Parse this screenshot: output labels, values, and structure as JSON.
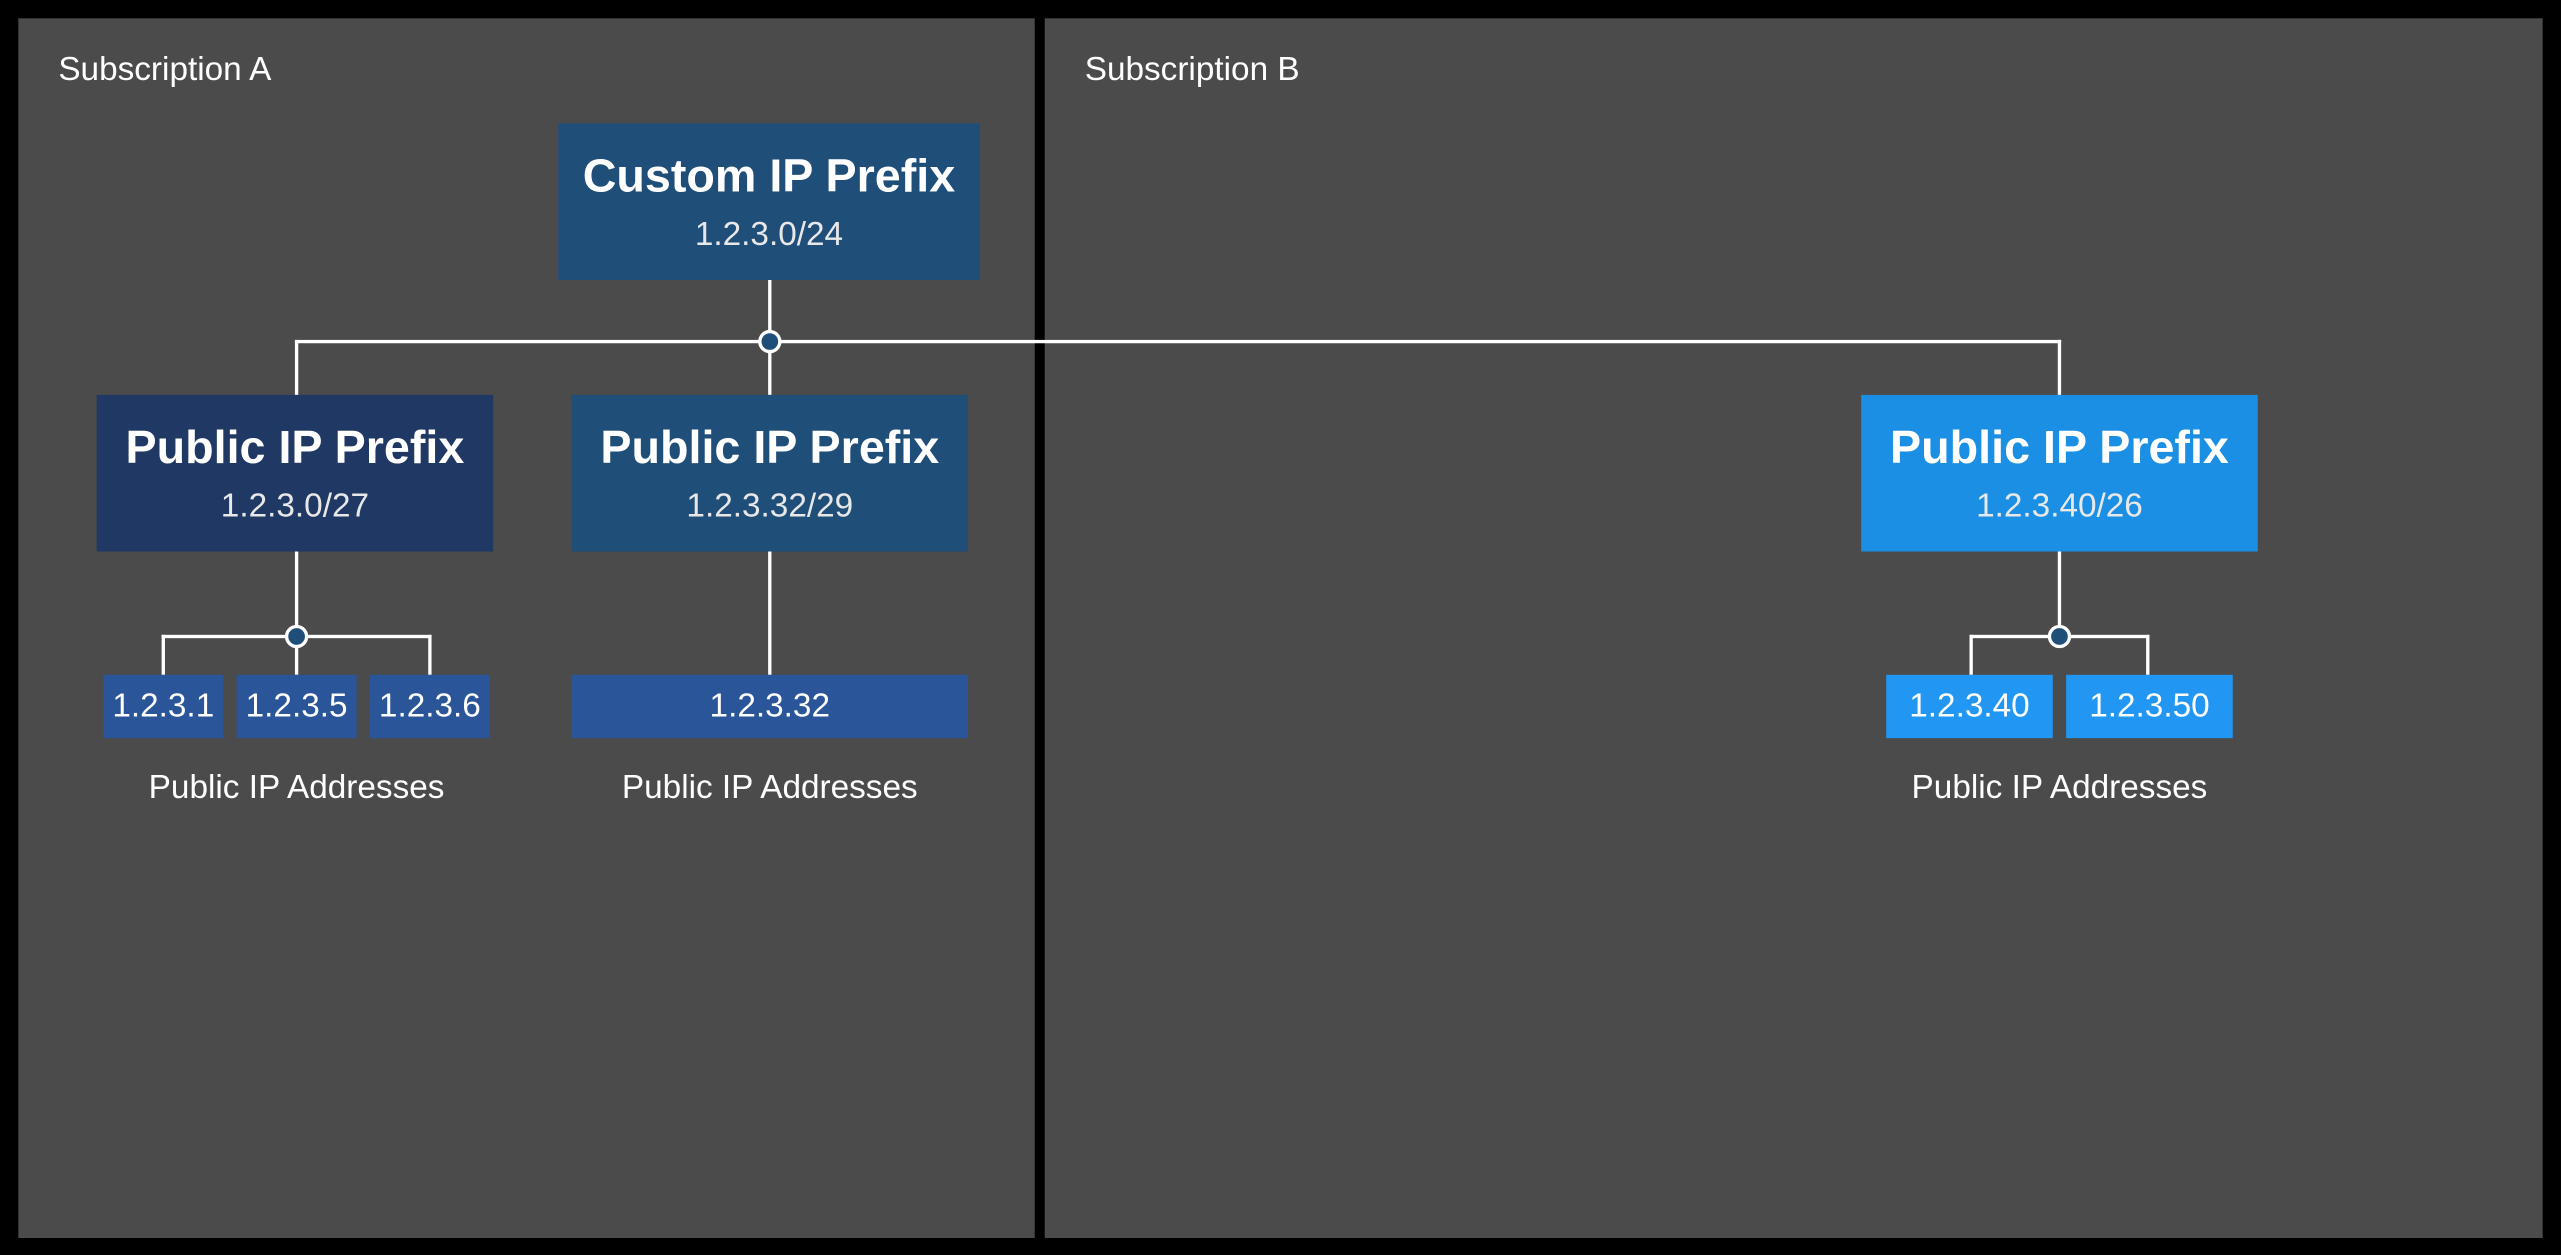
{
  "subscriptionA": {
    "label": "Subscription A"
  },
  "subscriptionB": {
    "label": "Subscription B"
  },
  "customPrefix": {
    "title": "Custom IP Prefix",
    "cidr": "1.2.3.0/24"
  },
  "publicPrefix1": {
    "title": "Public IP Prefix",
    "cidr": "1.2.3.0/27"
  },
  "publicPrefix2": {
    "title": "Public IP Prefix",
    "cidr": "1.2.3.32/29"
  },
  "publicPrefix3": {
    "title": "Public IP Prefix",
    "cidr": "1.2.3.40/26"
  },
  "ips1": {
    "a": "1.2.3.1",
    "b": "1.2.3.5",
    "c": "1.2.3.6"
  },
  "ips2": {
    "a": "1.2.3.32"
  },
  "ips3": {
    "a": "1.2.3.40",
    "b": "1.2.3.50"
  },
  "captions": {
    "addresses": "Public IP Addresses"
  },
  "colors": {
    "panel": "#4b4b4b",
    "darkBlue": "#1f3864",
    "medBlue": "#1f4e79",
    "brightBlue": "#1a8fe3",
    "ipDark": "#2a5599",
    "ipBright": "#2196f3"
  }
}
